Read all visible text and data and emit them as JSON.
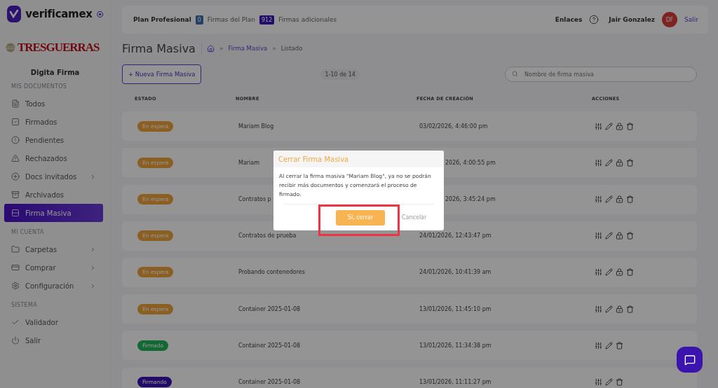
{
  "brand": {
    "name": "verificamex",
    "company": "TRESGUERRAS",
    "product": "Digita Firma"
  },
  "sidebar": {
    "sections": [
      {
        "title": "MIS DOCUMENTOS",
        "items": [
          {
            "label": "Todos",
            "selected": false,
            "has_submenu": false
          },
          {
            "label": "Firmados",
            "selected": false,
            "has_submenu": false
          },
          {
            "label": "Pendientes",
            "selected": false,
            "has_submenu": false
          },
          {
            "label": "Rechazados",
            "selected": false,
            "has_submenu": false
          },
          {
            "label": "Docs invitados",
            "selected": false,
            "has_submenu": true
          },
          {
            "label": "Archivados",
            "selected": false,
            "has_submenu": false
          },
          {
            "label": "Firma Masiva",
            "selected": true,
            "has_submenu": false
          }
        ]
      },
      {
        "title": "MI CUENTA",
        "items": [
          {
            "label": "Carpetas",
            "selected": false,
            "has_submenu": true
          },
          {
            "label": "Comprar",
            "selected": false,
            "has_submenu": true
          },
          {
            "label": "Configuración",
            "selected": false,
            "has_submenu": true
          }
        ]
      },
      {
        "title": "SISTEMA",
        "items": [
          {
            "label": "Validador",
            "selected": false,
            "has_submenu": false
          },
          {
            "label": "Salir",
            "selected": false,
            "has_submenu": false
          }
        ]
      }
    ]
  },
  "topbar": {
    "plan": "Plan Profesional",
    "plan_count": "0",
    "plan_label": "Firmas del Plan",
    "extra_count": "912",
    "extra_label": "Firmas adicionales",
    "links": "Enlaces",
    "user": "Jair Gonzalez",
    "avatar": "DF",
    "logout": "Salir"
  },
  "page": {
    "title": "Firma Masiva",
    "breadcrumb": [
      {
        "separator": "»",
        "label": "Firma Masiva"
      },
      {
        "separator": "»",
        "label": "Listado"
      }
    ],
    "new_button": "+ Nueva Firma Masiva",
    "pagination": "1-10 de 14",
    "search": {
      "placeholder": "Nombre de firma masiva"
    }
  },
  "table": {
    "columns": [
      "ESTADO",
      "NOMBRE",
      "FECHA DE CREACIÓN",
      "ACCIONES"
    ],
    "rows": [
      {
        "status": "En espera",
        "kind": "waiting",
        "name": "Mariam Blog",
        "date": "03/02/2026, 4:46:00 pm",
        "partly_hidden": false,
        "lockable": true
      },
      {
        "status": "En espera",
        "kind": "waiting",
        "name": "Mariam",
        "date": "2026, 4:00:55 pm",
        "partly_hidden": true,
        "lockable": true
      },
      {
        "status": "En espera",
        "kind": "waiting",
        "name": "Contratos p",
        "date": "2026, 3:45:24 pm",
        "partly_hidden": true,
        "lockable": true
      },
      {
        "status": "En espera",
        "kind": "waiting",
        "name": "Contratos de prueba",
        "date": "24/01/2026, 12:43:47 pm",
        "partly_hidden": false,
        "lockable": true
      },
      {
        "status": "En espera",
        "kind": "waiting",
        "name": "Probando contenedores",
        "date": "24/01/2026, 10:41:39 am",
        "partly_hidden": false,
        "lockable": true
      },
      {
        "status": "En espera",
        "kind": "waiting",
        "name": "Container 2025-01-08",
        "date": "13/01/2026, 11:45:10 pm",
        "partly_hidden": false,
        "lockable": true
      },
      {
        "status": "Firmado",
        "kind": "signed",
        "name": "Container 2025-01-08",
        "date": "13/01/2026, 11:34:38 pm",
        "partly_hidden": false,
        "lockable": false
      },
      {
        "status": "Firmando",
        "kind": "signing",
        "name": "Container 2025-01-08",
        "date": "13/01/2026, 11:11:27 pm",
        "partly_hidden": false,
        "lockable": false
      }
    ]
  },
  "dialog": {
    "title": "Cerrar Firma Masiva",
    "message": "Al cerrar la firma masiva \"Mariam Blog\", ya no se podrán recibir más documentos y comenzará el proceso de firmado.",
    "confirm": "Sí, cerrar",
    "cancel": "Cancelar",
    "confirm_highlighted": true
  }
}
